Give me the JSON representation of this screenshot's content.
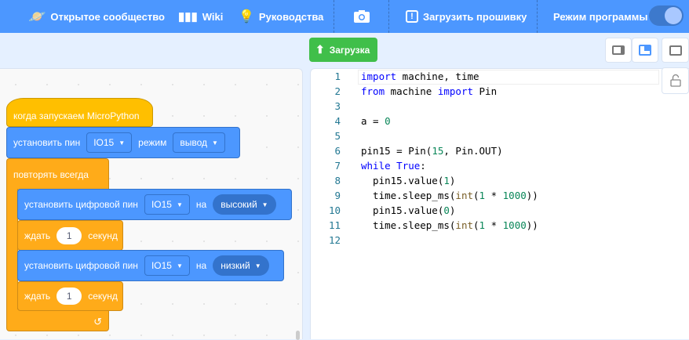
{
  "header": {
    "community": "Открытое сообщество",
    "wiki": "Wiki",
    "guides": "Руководства",
    "firmware": "Загрузить прошивку",
    "program_mode": "Режим программы",
    "program_mode_on": true,
    "accent": "#4c97ff"
  },
  "toolbar": {
    "upload": "Загрузка"
  },
  "blocks": {
    "hat": "когда запускаем MicroPython",
    "set_pin": {
      "label": "установить пин",
      "pin": "IO15",
      "mode_label": "режим",
      "mode": "вывод"
    },
    "forever": "повторять всегда",
    "digital1": {
      "label": "установить цифровой пин",
      "pin": "IO15",
      "to": "на",
      "value": "высокий"
    },
    "wait1": {
      "label": "ждать",
      "value": "1",
      "unit": "секунд"
    },
    "digital2": {
      "label": "установить цифровой пин",
      "pin": "IO15",
      "to": "на",
      "value": "низкий"
    },
    "wait2": {
      "label": "ждать",
      "value": "1",
      "unit": "секунд"
    }
  },
  "code": [
    "import machine, time",
    "from machine import Pin",
    "",
    "a = 0",
    "",
    "pin15 = Pin(15, Pin.OUT)",
    "while True:",
    "  pin15.value(1)",
    "  time.sleep_ms(int(1 * 1000))",
    "  pin15.value(0)",
    "  time.sleep_ms(int(1 * 1000))",
    ""
  ]
}
